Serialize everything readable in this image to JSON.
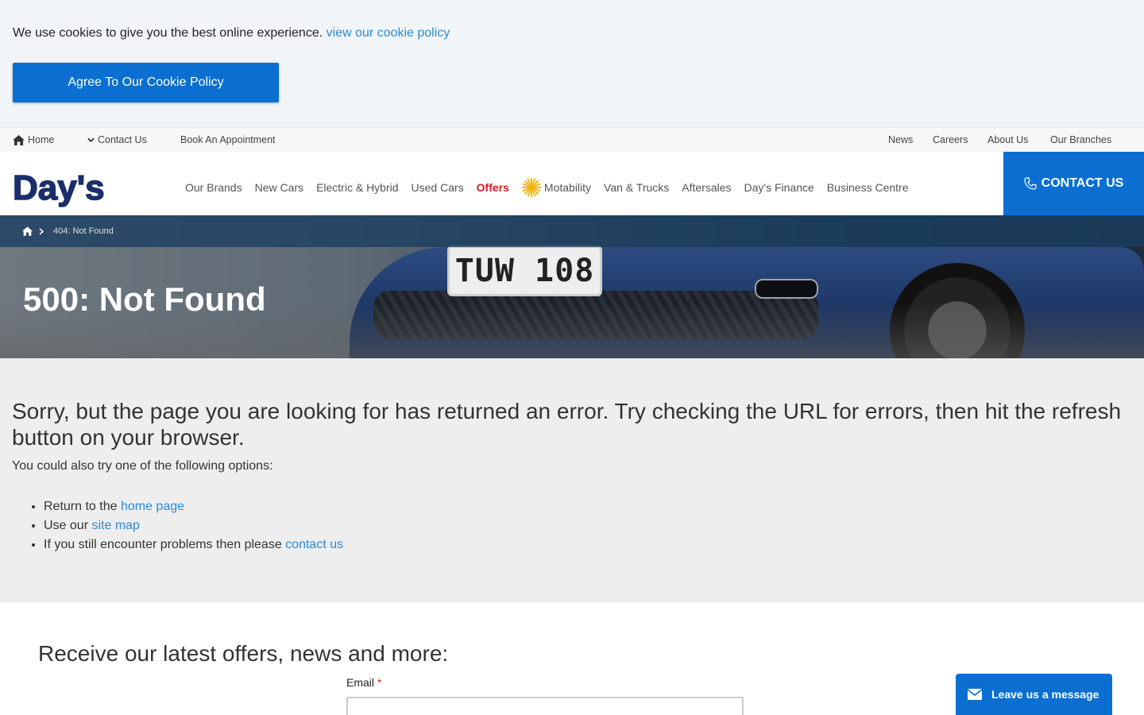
{
  "cookie": {
    "text": "We use cookies to give you the best online experience.",
    "link": "view our cookie policy",
    "button": "Agree To Our Cookie Policy"
  },
  "topbar": {
    "left": [
      "Home",
      "Contact Us",
      "Book An Appointment"
    ],
    "right": [
      "News",
      "Careers",
      "About Us",
      "Our Branches"
    ]
  },
  "header": {
    "logo": "Day's",
    "nav": [
      "Our Brands",
      "New Cars",
      "Electric & Hybrid",
      "Used Cars",
      "Offers",
      "Motability",
      "Van & Trucks",
      "Aftersales",
      "Day's Finance",
      "Business Centre"
    ],
    "cta": "CONTACT US"
  },
  "hero": {
    "breadcrumb_current": "404: Not Found",
    "title": "500: Not Found",
    "plate": "TUW 108"
  },
  "error": {
    "heading": "Sorry, but the page you are looking for has returned an error. Try checking the URL for errors, then hit the refresh button on your browser.",
    "sub": "You could also try one of the following options:",
    "options": [
      {
        "prefix": "Return to the ",
        "link": "home page"
      },
      {
        "prefix": "Use our ",
        "link": "site map"
      },
      {
        "prefix": "If you still encounter problems then please ",
        "link": "contact us"
      }
    ]
  },
  "newsletter": {
    "title": "Receive our latest offers, news and more:",
    "email_label": "Email",
    "required_mark": "*"
  },
  "chat": {
    "label": "Leave us a message"
  },
  "colors": {
    "primary": "#0a6fd1",
    "link": "#2a8bd6",
    "offers": "#d11f1f",
    "logo_navy": "#1a2e6b"
  }
}
